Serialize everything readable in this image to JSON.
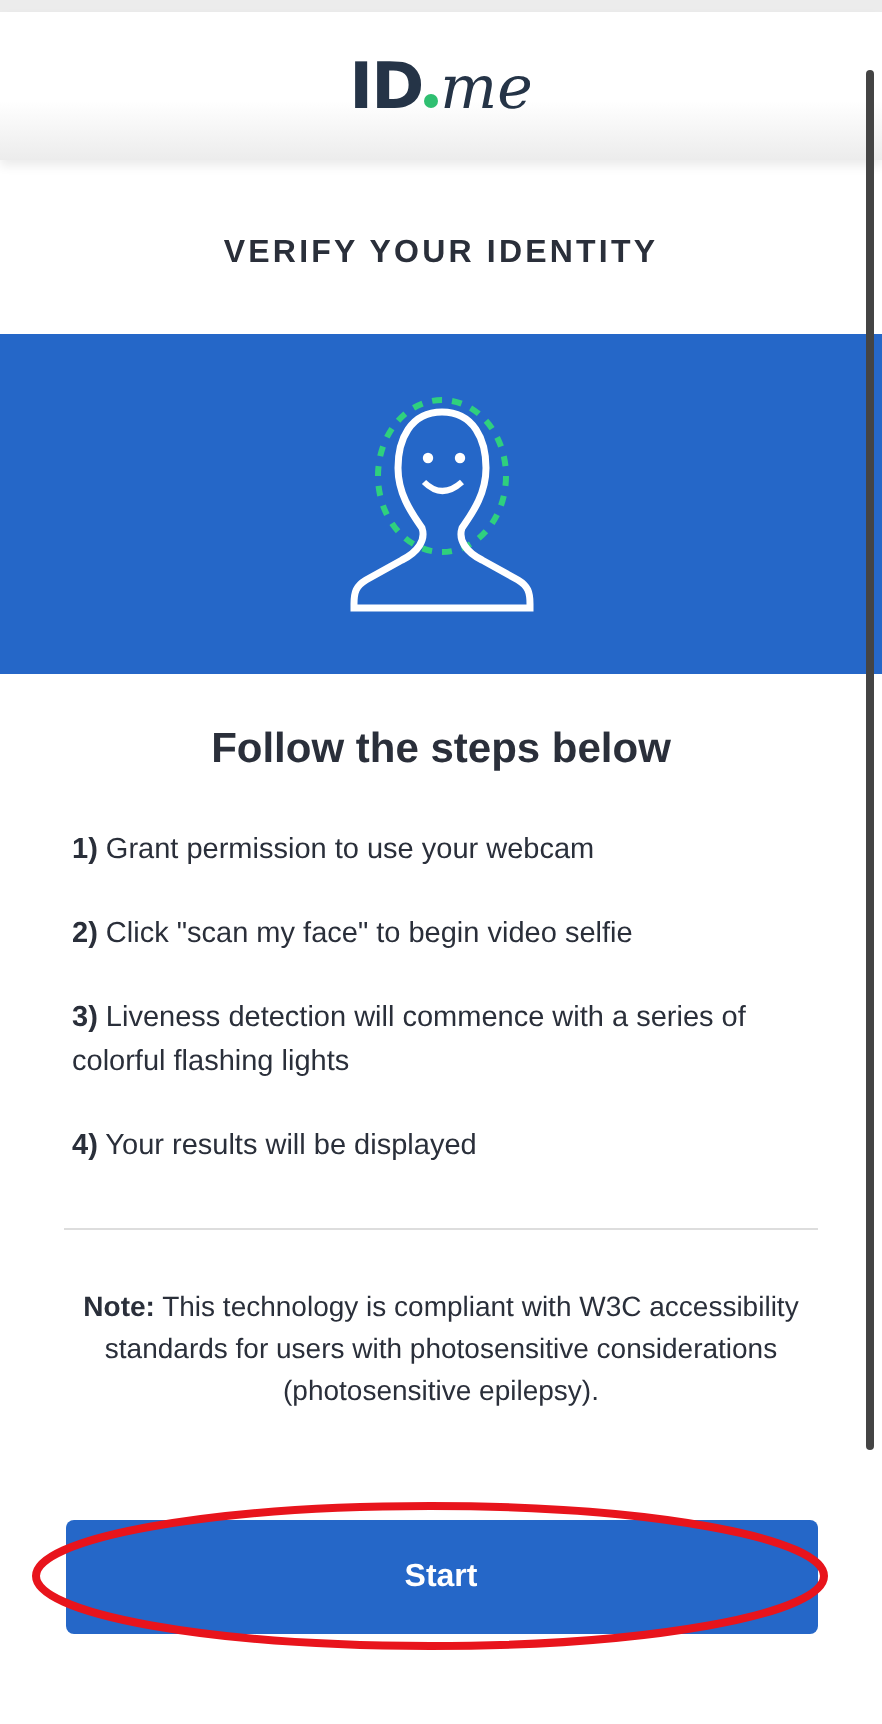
{
  "logo": {
    "prefix": "ID",
    "suffix": "me"
  },
  "title": "VERIFY YOUR IDENTITY",
  "heading": "Follow the steps below",
  "steps": [
    "**1)** Grant permission to use your webcam",
    "**2)** Click \"scan my face\" to begin video selfie",
    "**3)** Liveness detection will commence with a series of colorful flashing lights",
    "**4)** Your results will be displayed"
  ],
  "note": [
    "**Note:** This technology is compliant with W3C accessibility standards for users with photosensitive considerations",
    "(photosensitive epilepsy)."
  ],
  "start_button": {
    "label": "Start",
    "highlighted": true
  }
}
